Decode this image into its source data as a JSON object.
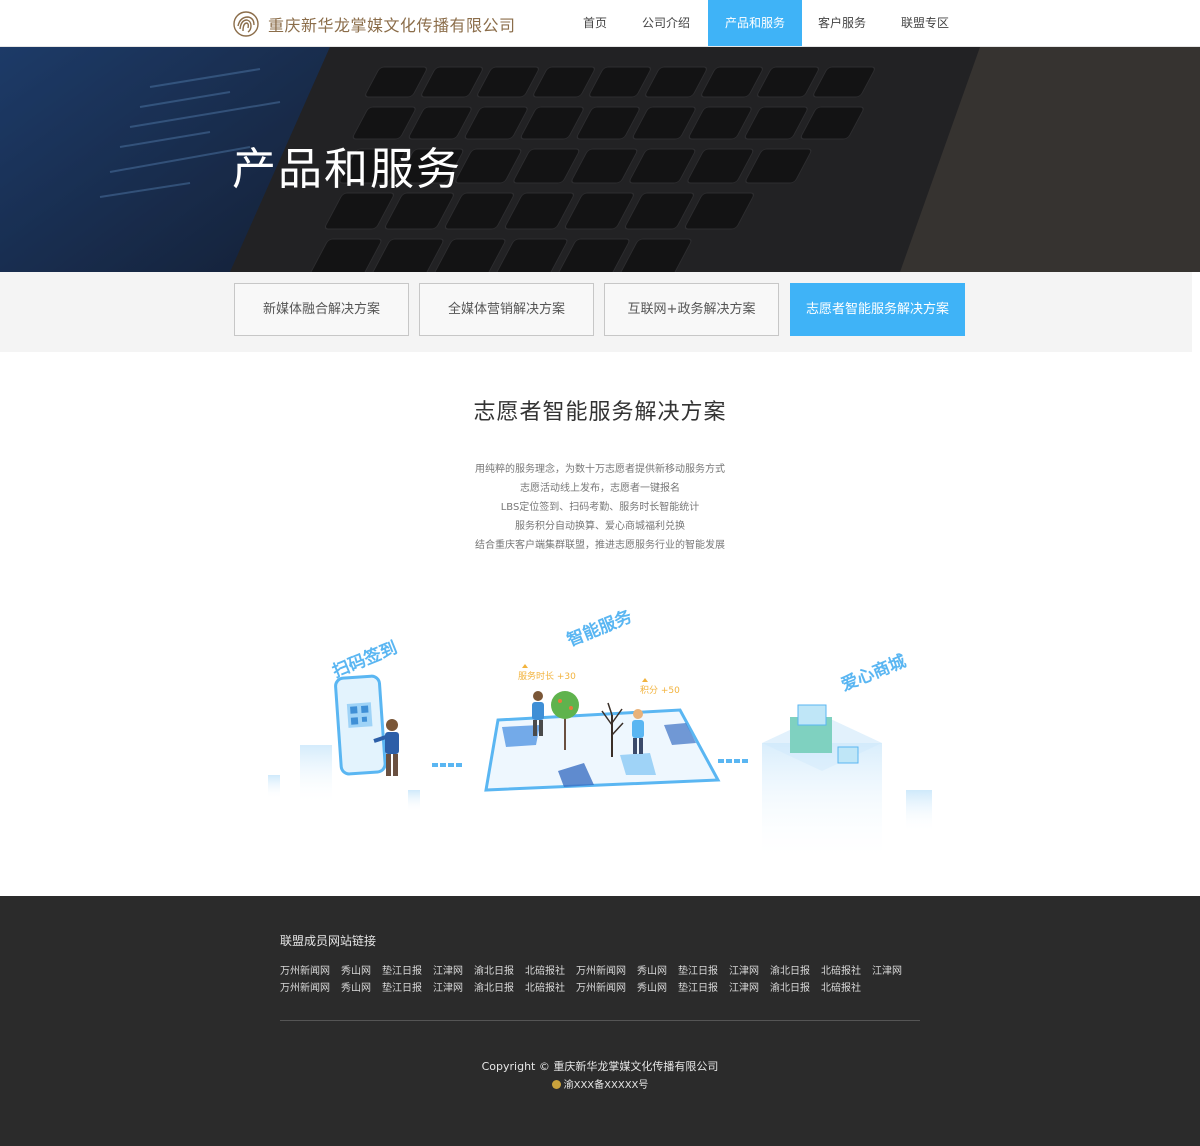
{
  "header": {
    "company": "重庆新华龙掌媒文化传播有限公司",
    "nav": [
      {
        "label": "首页",
        "active": false
      },
      {
        "label": "公司介绍",
        "active": false
      },
      {
        "label": "产品和服务",
        "active": true
      },
      {
        "label": "客户服务",
        "active": false
      },
      {
        "label": "联盟专区",
        "active": false
      }
    ]
  },
  "banner": {
    "title": "产品和服务"
  },
  "tabs": [
    {
      "label": "新媒体融合解决方案",
      "active": false
    },
    {
      "label": "全媒体营销解决方案",
      "active": false
    },
    {
      "label": "互联网+政务解决方案",
      "active": false
    },
    {
      "label": "志愿者智能服务解决方案",
      "active": true
    }
  ],
  "main": {
    "title": "志愿者智能服务解决方案",
    "description": [
      "用纯粹的服务理念，为数十万志愿者提供新移动服务方式",
      "志愿活动线上发布，志愿者一键报名",
      "LBS定位签到、扫码考勤、服务时长智能统计",
      "服务积分自动换算、爱心商城福利兑换",
      "结合重庆客户端集群联盟，推进志愿服务行业的智能发展"
    ],
    "illustration": {
      "label_scan": "扫码签到",
      "label_smart": "智能服务",
      "label_mall": "爱心商城",
      "badge_hours": "服务时长 +30",
      "badge_points": "积分 +50"
    }
  },
  "footer": {
    "links_heading": "联盟成员网站链接",
    "links_row1": [
      "万州新闻网",
      "秀山网",
      "垫江日报",
      "江津网",
      "渝北日报",
      "北碚报社",
      "万州新闻网",
      "秀山网",
      "垫江日报",
      "江津网",
      "渝北日报",
      "北碚报社",
      "江津网"
    ],
    "links_row2": [
      "万州新闻网",
      "秀山网",
      "垫江日报",
      "江津网",
      "渝北日报",
      "北碚报社",
      "万州新闻网",
      "秀山网",
      "垫江日报",
      "江津网",
      "渝北日报",
      "北碚报社"
    ],
    "copyright": "Copyright © 重庆新华龙掌媒文化传播有限公司",
    "icp": "渝XXX备XXXXX号"
  },
  "colors": {
    "accent": "#3fb3f7",
    "brand": "#8b6d4a",
    "footer_bg": "#2b2b2b"
  }
}
